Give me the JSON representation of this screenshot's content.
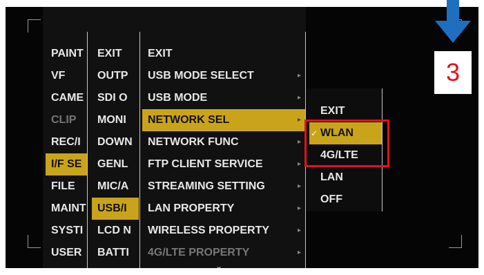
{
  "menus": {
    "main": [
      "PAINT",
      "VF",
      "CAME",
      "CLIP",
      "REC/I",
      "I/F SE",
      "FILE",
      "MAINT",
      "SYSTI",
      "USER"
    ],
    "second": [
      "EXIT",
      "OUTP",
      "SDI O",
      "MONI",
      "DOWN",
      "GENL",
      "MIC/A",
      "USB/I",
      "LCD N",
      "BATTI"
    ],
    "third": [
      {
        "label": "EXIT",
        "arrow": ""
      },
      {
        "label": "USB MODE SELECT",
        "arrow": "▸"
      },
      {
        "label": "USB MODE",
        "arrow": "▸"
      },
      {
        "label": "NETWORK SEL",
        "arrow": "▸"
      },
      {
        "label": "NETWORK FUNC",
        "arrow": "▸"
      },
      {
        "label": "FTP CLIENT SERVICE",
        "arrow": "▸"
      },
      {
        "label": "STREAMING SETTING",
        "arrow": "▸"
      },
      {
        "label": "LAN PROPERTY",
        "arrow": "▸"
      },
      {
        "label": "WIRELESS PROPERTY",
        "arrow": "▸"
      },
      {
        "label": "4G/LTE PROPERTY",
        "arrow": "▸"
      }
    ],
    "options": [
      "EXIT",
      "WLAN",
      "4G/LTE",
      "LAN",
      "OFF"
    ],
    "options_checkmark": "✓",
    "scroll_indicator": "⌄"
  },
  "step_badge": "3",
  "colors": {
    "selection": "#c9a41b",
    "highlight_box": "#e3121a",
    "step_arrow": "#1f6fc1"
  },
  "icons": [
    "down-arrow-icon",
    "checkmark-icon",
    "submenu-arrow-icon",
    "scroll-down-icon"
  ]
}
